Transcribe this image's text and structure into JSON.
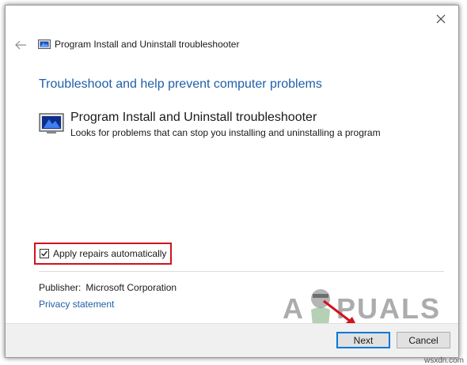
{
  "window": {
    "title": "Program Install and Uninstall troubleshooter",
    "close_icon": "close-icon",
    "back_icon": "back-arrow-icon"
  },
  "main": {
    "heading": "Troubleshoot and help prevent computer problems",
    "program": {
      "name": "Program Install and Uninstall troubleshooter",
      "description": "Looks for problems that can stop you installing and uninstalling a program"
    },
    "apply_repairs": {
      "label": "Apply repairs automatically",
      "checked": true
    },
    "publisher": {
      "label": "Publisher:",
      "value": "Microsoft Corporation"
    },
    "privacy_link": "Privacy statement"
  },
  "footer": {
    "next_label": "Next",
    "cancel_label": "Cancel"
  },
  "watermark": {
    "text_pre": "A",
    "text_post": "PUALS",
    "site": "wsxdn.com"
  },
  "colors": {
    "accent": "#1f5fa8",
    "highlight": "#d0131b",
    "focus": "#0078d7"
  }
}
